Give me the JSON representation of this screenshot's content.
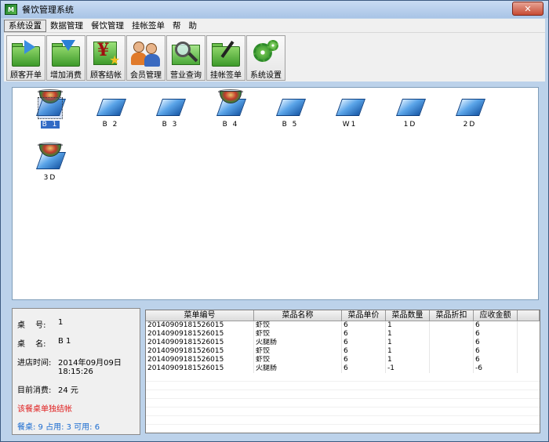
{
  "window": {
    "title": "餐饮管理系统",
    "app_icon": "M",
    "close_label": "✕"
  },
  "menu": [
    "系统设置",
    "数据管理",
    "餐饮管理",
    "挂帐签单",
    "帮",
    "助"
  ],
  "toolbar": [
    "顾客开单",
    "增加消费",
    "顾客结帐",
    "会员管理",
    "营业查询",
    "挂帐签单",
    "系统设置"
  ],
  "tables": [
    {
      "label": "B 1",
      "occupied": true,
      "selected": true
    },
    {
      "label": "B 2",
      "occupied": false
    },
    {
      "label": "B 3",
      "occupied": false
    },
    {
      "label": "B 4",
      "occupied": true
    },
    {
      "label": "B 5",
      "occupied": false
    },
    {
      "label": "W1",
      "occupied": false
    },
    {
      "label": "1D",
      "occupied": false
    },
    {
      "label": "2D",
      "occupied": false
    },
    {
      "label": "3D",
      "occupied": true
    }
  ],
  "info": {
    "table_no_label": "桌　 号:",
    "table_no": "1",
    "table_name_label": "桌　 名:",
    "table_name": "B 1",
    "time_label": "进店时间:",
    "time_date": "2014年09月09日",
    "time_clock": "18:15:26",
    "spend_label": "目前消费:",
    "spend": "24 元",
    "warning": "该餐桌单独结帐",
    "availability": "餐桌: 9 占用: 3 可用: 6"
  },
  "grid": {
    "headers": [
      "菜单编号",
      "菜品名称",
      "菜品单价",
      "菜品数量",
      "菜品折扣",
      "应收金额"
    ],
    "rows": [
      [
        "20140909181526015",
        "虾饺",
        "6",
        "1",
        "",
        "6"
      ],
      [
        "20140909181526015",
        "虾饺",
        "6",
        "1",
        "",
        "6"
      ],
      [
        "20140909181526015",
        "火腿肠",
        "6",
        "1",
        "",
        "6"
      ],
      [
        "20140909181526015",
        "虾饺",
        "6",
        "1",
        "",
        "6"
      ],
      [
        "20140909181526015",
        "虾饺",
        "6",
        "1",
        "",
        "6"
      ],
      [
        "20140909181526015",
        "火腿肠",
        "6",
        "-1",
        "",
        "-6"
      ]
    ]
  }
}
